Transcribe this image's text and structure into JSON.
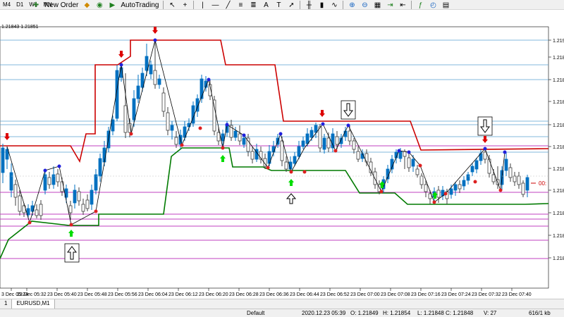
{
  "toolbar1": {
    "timeframes": [
      "M4",
      "D1",
      "W1",
      "MN"
    ]
  },
  "toolbar2": {
    "new_order_label": "New Order",
    "autotrading_label": "AutoTrading"
  },
  "chart": {
    "header_prices": "1.21843 1.21851",
    "price_labels": [
      "1.219",
      "1.218",
      "1.218",
      "1.218",
      "1.218",
      "1.218",
      "1.218",
      "1.218",
      "1.218",
      "1.218",
      "1.218"
    ],
    "time_labels": [
      "3 Dec 05:24",
      "23 Dec 05:32",
      "23 Dec 05:40",
      "23 Dec 05:48",
      "23 Dec 05:56",
      "23 Dec 06:04",
      "23 Dec 06:12",
      "23 Dec 06:20",
      "23 Dec 06:28",
      "23 Dec 06:36",
      "23 Dec 06:44",
      "23 Dec 06:52",
      "23 Dec 07:00",
      "23 Dec 07:08",
      "23 Dec 07:16",
      "23 Dec 07:24",
      "23 Dec 07:32",
      "23 Dec 07:40"
    ],
    "countdown": "00:",
    "colors": {
      "bull": "#0070c0",
      "bear": "#404040",
      "resistance": "#cc0000",
      "support": "#007a00",
      "hline_blue": "#5aa0d0",
      "hline_violet": "#c040c0",
      "zigzag": "#000000",
      "arrow_up": "#00dd00",
      "arrow_down": "#dd0000"
    }
  },
  "tabs": [
    {
      "label": "1"
    },
    {
      "label": "EURUSD,M1"
    }
  ],
  "status": {
    "profile": "Default",
    "datetime": "2020.12.23 05:39",
    "open": "O: 1.21849",
    "high": "H: 1.21854",
    "low": "L: 1.21848",
    "close": "C: 1.21848",
    "volume": "V: 27",
    "traffic": "616/1 kb"
  }
}
